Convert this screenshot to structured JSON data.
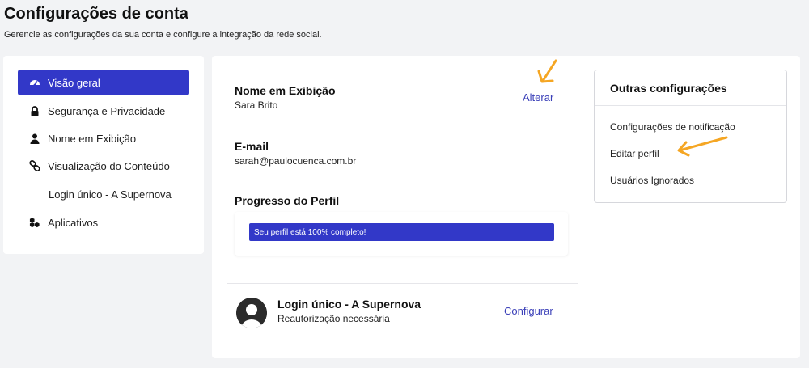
{
  "header": {
    "title": "Configurações de conta",
    "subtitle": "Gerencie as configurações da sua conta e configure a integração da rede social."
  },
  "sidebar": {
    "items": [
      {
        "label": "Visão geral",
        "icon": "dashboard-icon",
        "active": true
      },
      {
        "label": "Segurança e Privacidade",
        "icon": "lock-icon"
      },
      {
        "label": "Nome em Exibição",
        "icon": "user-icon"
      },
      {
        "label": "Visualização do Conteúdo",
        "icon": "link-icon"
      },
      {
        "label": "Login único - A Supernova",
        "icon": ""
      },
      {
        "label": "Aplicativos",
        "icon": "apps-icon"
      }
    ]
  },
  "main": {
    "display_name": {
      "title": "Nome em Exibição",
      "value": "Sara Brito",
      "action": "Alterar"
    },
    "email": {
      "title": "E-mail",
      "value": "sarah@paulocuenca.com.br"
    },
    "profile_progress": {
      "title": "Progresso do Perfil",
      "label": "Seu perfil está 100% completo!",
      "percent": 100
    },
    "sso": {
      "title": "Login único - A Supernova",
      "status": "Reautorização necessária",
      "action": "Configurar"
    }
  },
  "other_settings": {
    "title": "Outras configurações",
    "links": [
      "Configurações de notificação",
      "Editar perfil",
      "Usuários Ignorados"
    ]
  },
  "colors": {
    "accent": "#3238c8",
    "annotation_arrow": "#f5a623"
  }
}
